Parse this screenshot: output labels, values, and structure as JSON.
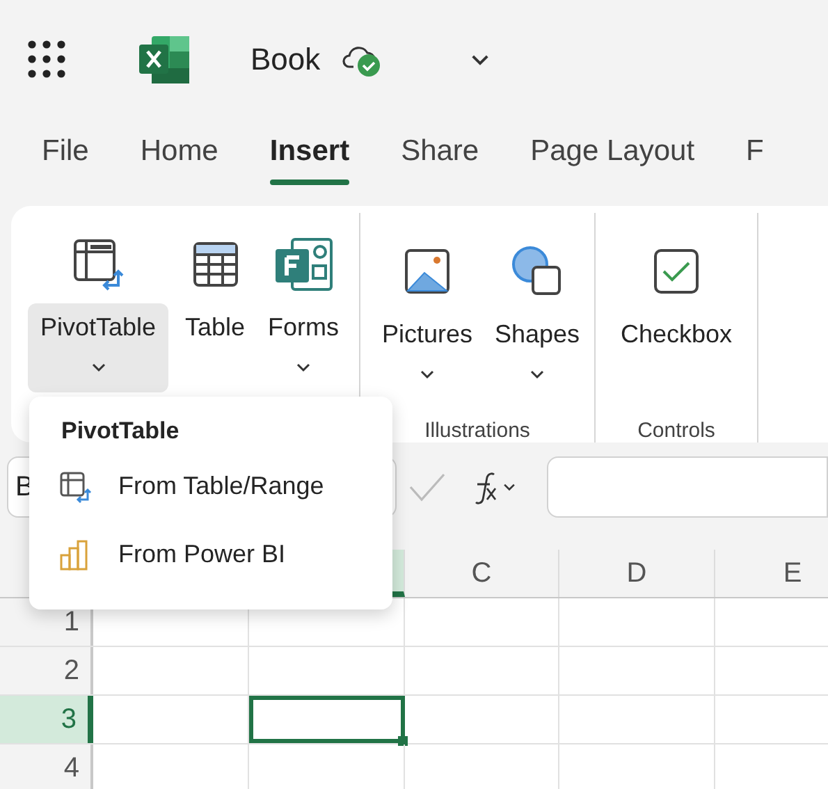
{
  "title_bar": {
    "document": "Book",
    "saved": true
  },
  "tabs": [
    {
      "label": "File",
      "selected": false
    },
    {
      "label": "Home",
      "selected": false
    },
    {
      "label": "Insert",
      "selected": true
    },
    {
      "label": "Share",
      "selected": false
    },
    {
      "label": "Page Layout",
      "selected": false
    },
    {
      "label": "F",
      "selected": false
    }
  ],
  "ribbon": {
    "groups": [
      {
        "buttons": [
          {
            "label": "PivotTable",
            "dropdown": true,
            "selected": true
          },
          {
            "label": "Table",
            "dropdown": false,
            "selected": false
          },
          {
            "label": "Forms",
            "dropdown": true,
            "selected": false
          }
        ]
      },
      {
        "label": "Illustrations",
        "buttons": [
          {
            "label": "Pictures",
            "dropdown": true,
            "selected": false
          },
          {
            "label": "Shapes",
            "dropdown": true,
            "selected": false
          }
        ]
      },
      {
        "label": "Controls",
        "buttons": [
          {
            "label": "Checkbox",
            "dropdown": false,
            "selected": false
          }
        ]
      }
    ]
  },
  "formula_bar": {
    "name_box": "B"
  },
  "grid": {
    "columns": [
      {
        "selected": true
      },
      {
        "label": "C",
        "selected": false
      },
      {
        "label": "D",
        "selected": false
      },
      {
        "label": "E",
        "selected": false
      }
    ],
    "rows": [
      {
        "label": "1",
        "selected": false
      },
      {
        "label": "2",
        "selected": false
      },
      {
        "label": "3",
        "selected": true
      },
      {
        "label": "4",
        "selected": false
      }
    ]
  },
  "dropdown_menu": {
    "title": "PivotTable",
    "items": [
      "From Table/Range",
      "From Power BI"
    ]
  }
}
